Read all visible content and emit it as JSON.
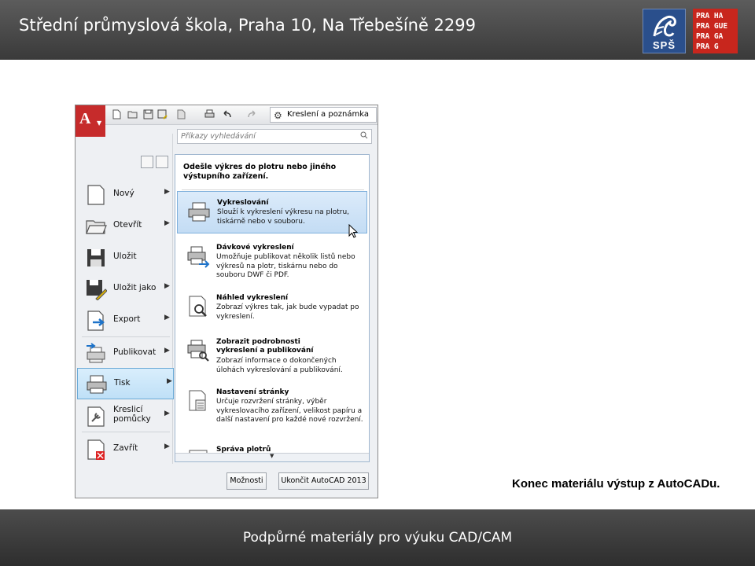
{
  "header": {
    "title": "Střední průmyslová škola, Praha 10, Na Třebešíně 2299",
    "logo_sps_text": "SPŠ",
    "logo_praha_lines": [
      "PRA HA",
      "PRA GUE",
      "PRA GA",
      "PRA G"
    ]
  },
  "footer": {
    "text": "Podpůrné materiály pro výuku CAD/CAM"
  },
  "caption": "Konec materiálu výstup z AutoCADu.",
  "app": {
    "app_button_letter": "A",
    "workspace_label": "Kreslení a poznámka",
    "search_placeholder": "Příkazy vyhledávání",
    "menu": [
      {
        "label": "Nový",
        "icon": "new-file-icon",
        "submenu": true
      },
      {
        "label": "Otevřít",
        "icon": "open-folder-icon",
        "submenu": true
      },
      {
        "label": "Uložit",
        "icon": "save-disk-icon",
        "submenu": false
      },
      {
        "label": "Uložit jako",
        "icon": "save-as-icon",
        "submenu": true
      },
      {
        "label": "Export",
        "icon": "export-icon",
        "submenu": true
      },
      {
        "label": "Publikovat",
        "icon": "publish-icon",
        "submenu": true
      },
      {
        "label": "Tisk",
        "icon": "printer-icon",
        "submenu": true,
        "selected": true
      },
      {
        "label": "Kreslicí\npomůcky",
        "icon": "drawing-utilities-icon",
        "submenu": true
      },
      {
        "label": "Zavřít",
        "icon": "close-file-icon",
        "submenu": true
      }
    ],
    "panel": {
      "heading": "Odešle výkres do plotru nebo jiného výstupního zařízení.",
      "items": [
        {
          "title": "Vykreslování",
          "desc": "Slouží k vykreslení výkresu na plotru, tiskárně nebo v souboru.",
          "icon": "plot-icon",
          "selected": true
        },
        {
          "title": "Dávkové vykreslení",
          "desc": "Umožňuje publikovat několik listů nebo výkresů na plotr, tiskárnu nebo do souboru DWF či PDF.",
          "icon": "batch-plot-icon"
        },
        {
          "title": "Náhled vykreslení",
          "desc": "Zobrazí výkres tak, jak bude vypadat po vykreslení.",
          "icon": "plot-preview-icon"
        },
        {
          "title": "Zobrazit podrobnosti vykreslení a publikování",
          "desc": "Zobrazí informace o dokončených úlohách vykreslování a publikování.",
          "icon": "plot-details-icon"
        },
        {
          "title": "Nastavení stránky",
          "desc": "Určuje rozvržení stránky, výběr vykreslovacího zařízení, velikost papíru a další nastavení pro každé nové rozvržení.",
          "icon": "page-setup-icon"
        },
        {
          "title": "Správa plotrů",
          "desc": "",
          "icon": "plotter-manager-icon"
        }
      ]
    },
    "options_button": "Možnosti",
    "exit_button": "Ukončit AutoCAD 2013"
  }
}
